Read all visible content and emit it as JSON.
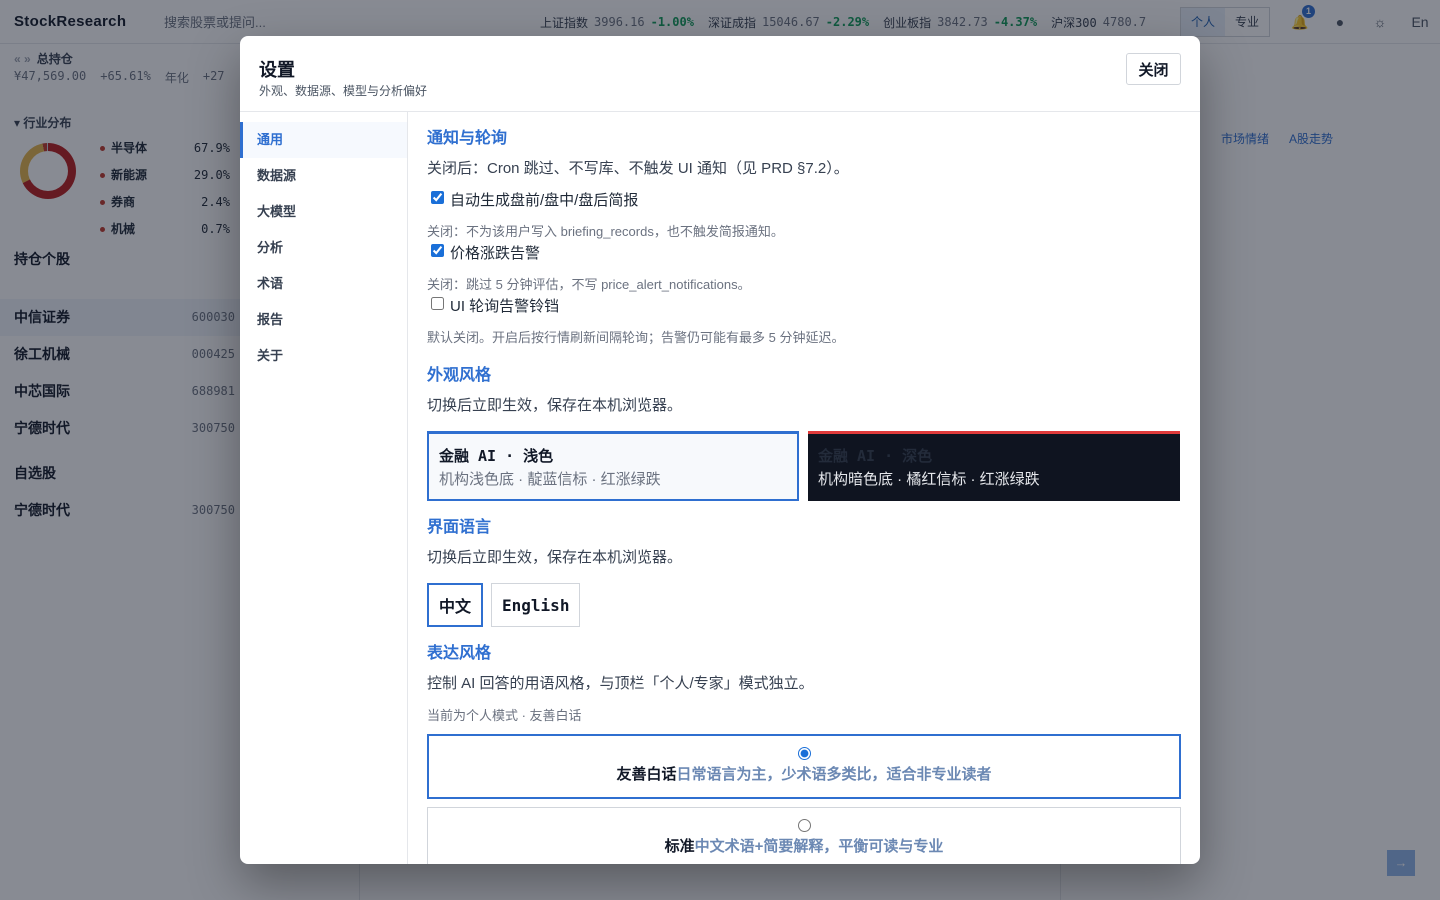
{
  "app": {
    "brand": "StockResearch",
    "search_placeholder": "搜索股票或提问...",
    "tickers": [
      {
        "name": "上证指数",
        "value": "3996.16",
        "change": "-1.00%"
      },
      {
        "name": "深证成指",
        "value": "15046.67",
        "change": "-2.29%"
      },
      {
        "name": "创业板指",
        "value": "3842.73",
        "change": "-4.37%"
      },
      {
        "name": "沪深300",
        "value": "4780.7",
        "change": ""
      }
    ],
    "mode_personal": "个人",
    "mode_expert": "专业",
    "notif_count": "1",
    "lang_toggle": "En",
    "colors": {
      "accent": "#2f6fd0",
      "down": "#0f9d58",
      "up": "#c0392b"
    }
  },
  "portfolio": {
    "nav_arrows": "« »",
    "title": "总持仓",
    "total": "¥47,569.00",
    "return": "+65.61%",
    "annual_label": "年化",
    "annual_value": "+27",
    "industry_title": "行业分布",
    "industries": [
      {
        "name": "半导体",
        "pct": "67.9%"
      },
      {
        "name": "新能源",
        "pct": "29.0%"
      },
      {
        "name": "券商",
        "pct": "2.4%"
      },
      {
        "name": "机械",
        "pct": "0.7%"
      }
    ],
    "holdings_title": "持仓个股",
    "holdings": [
      {
        "name": "中信证券",
        "code": "600030"
      },
      {
        "name": "徐工机械",
        "code": "000425"
      },
      {
        "name": "中芯国际",
        "code": "688981"
      },
      {
        "name": "宁德时代",
        "code": "300750"
      }
    ],
    "watch_title": "自选股",
    "watchlist": [
      {
        "name": "宁德时代",
        "code": "300750"
      }
    ]
  },
  "right_pane": {
    "tabs": [
      "市场情绪",
      "A股走势"
    ],
    "send_icon": "arrow-right-icon"
  },
  "modal": {
    "title": "设置",
    "subtitle": "外观、数据源、模型与分析偏好",
    "close_label": "关闭",
    "nav": [
      "通用",
      "数据源",
      "大模型",
      "分析",
      "术语",
      "报告",
      "关于"
    ],
    "notify": {
      "title": "通知与轮询",
      "desc": "关闭后：Cron 跳过、不写库、不触发 UI 通知（见 PRD §7.2）。",
      "options": [
        {
          "label": "自动生成盘前/盘中/盘后简报",
          "checked": true,
          "hint": "关闭：不为该用户写入 briefing_records，也不触发简报通知。"
        },
        {
          "label": "价格涨跌告警",
          "checked": true,
          "hint": "关闭：跳过 5 分钟评估，不写 price_alert_notifications。"
        },
        {
          "label": "UI 轮询告警铃铛",
          "checked": false,
          "hint": "默认关闭。开启后按行情刷新间隔轮询；告警仍可能有最多 5 分钟延迟。"
        }
      ]
    },
    "appearance": {
      "title": "外观风格",
      "desc": "切换后立即生效，保存在本机浏览器。",
      "themes": [
        {
          "name": "金融 AI · 浅色",
          "desc": "机构浅色底 · 靛蓝信标 · 红涨绿跌"
        },
        {
          "name": "金融 AI · 深色",
          "desc": "机构暗色底 · 橘红信标 · 红涨绿跌"
        }
      ]
    },
    "language": {
      "title": "界面语言",
      "desc": "切换后立即生效，保存在本机浏览器。",
      "options": [
        "中文",
        "English"
      ]
    },
    "style": {
      "title": "表达风格",
      "desc": "控制 AI 回答的用语风格，与顶栏「个人/专家」模式独立。",
      "current": "当前为个人模式 · 友善白话",
      "options": [
        {
          "name": "友善白话",
          "desc": "日常语言为主，少术语多类比，适合非专业读者",
          "selected": true
        },
        {
          "name": "标准",
          "desc": "中文术语+简要解释，平衡可读与专业",
          "selected": false
        }
      ]
    }
  }
}
